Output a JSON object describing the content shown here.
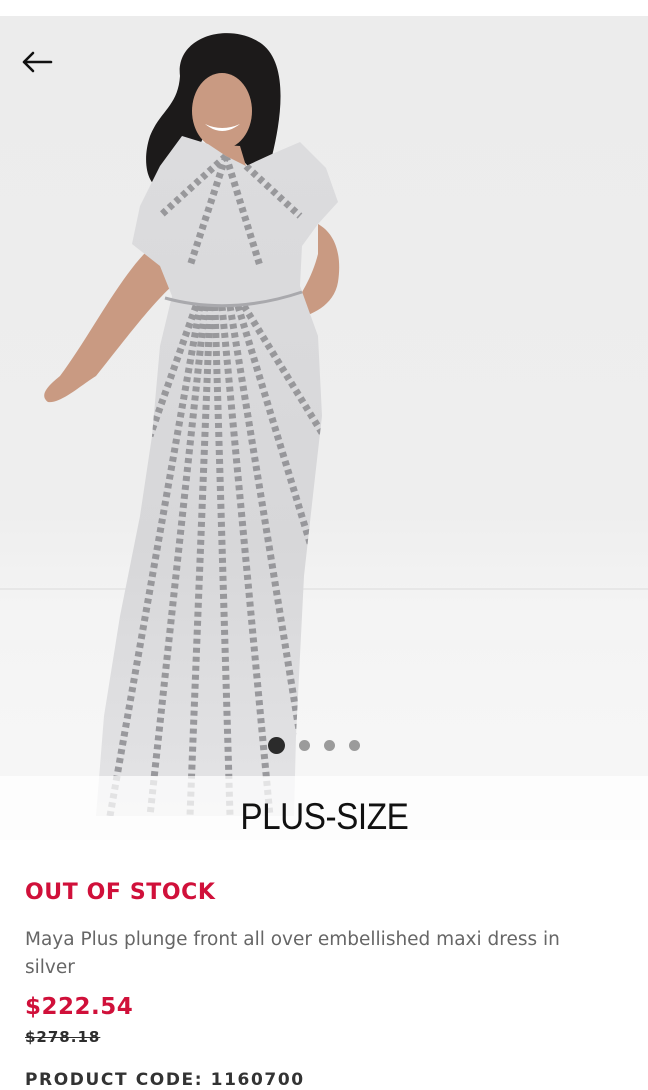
{
  "product": {
    "badge": "PLUS-SIZE",
    "stock_status": "OUT OF STOCK",
    "title": "Maya Plus plunge front all over embellished maxi dress in silver",
    "price": "$222.54",
    "original_price": "$278.18",
    "product_code_partial": "PRODUCT CODE: 1160700"
  },
  "carousel": {
    "total_images": 4,
    "current_image": 1
  },
  "icons": {
    "back": "arrow-left-icon"
  },
  "colors": {
    "accent": "#d0103a",
    "text_muted": "#666666",
    "dot_active": "#2b2b2b",
    "dot_inactive": "#9b9b9b"
  }
}
